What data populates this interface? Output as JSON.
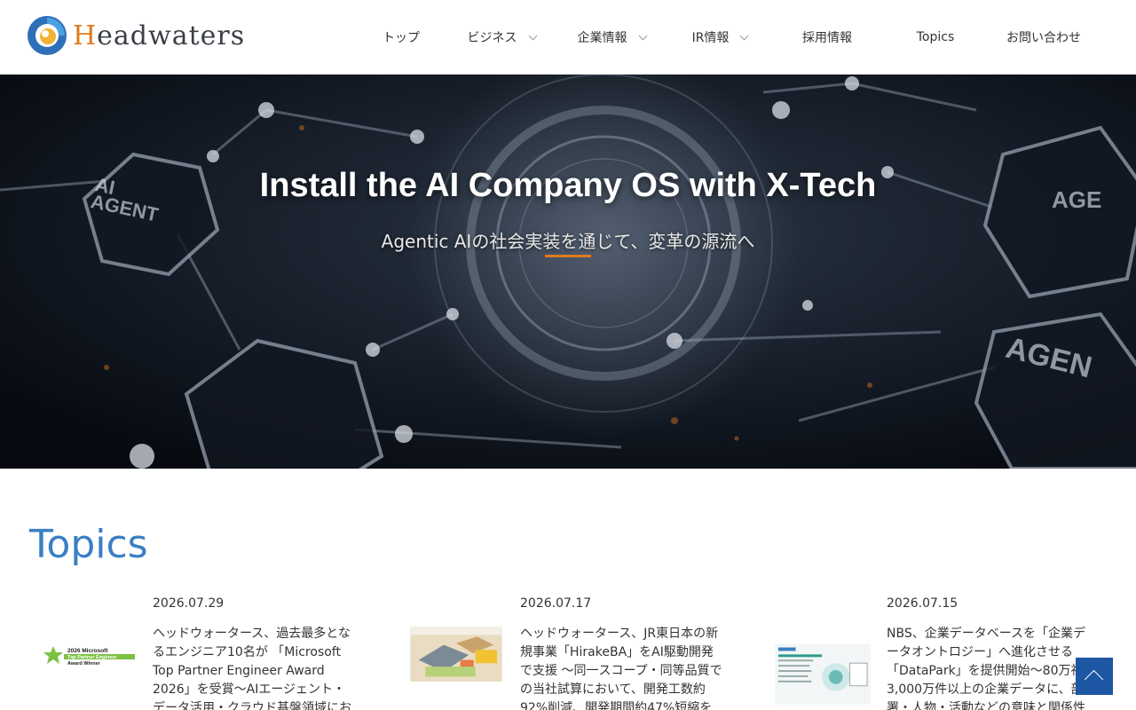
{
  "header": {
    "logo_text_initial": "H",
    "logo_text_rest": "eadwaters",
    "nav": [
      {
        "label": "トップ",
        "has_dropdown": false
      },
      {
        "label": "ビジネス",
        "has_dropdown": true
      },
      {
        "label": "企業情報",
        "has_dropdown": true
      },
      {
        "label": "IR情報",
        "has_dropdown": true
      },
      {
        "label": "採用情報",
        "has_dropdown": false
      },
      {
        "label": "Topics",
        "has_dropdown": false
      },
      {
        "label": "お問い合わせ",
        "has_dropdown": false
      }
    ]
  },
  "hero": {
    "title": "Install the AI Company OS with X-Tech",
    "subtitle": "Agentic AIの社会実装を通じて、変革の源流へ",
    "accent_color": "#e07a1f"
  },
  "topics": {
    "heading": "Topics",
    "items": [
      {
        "date": "2026.07.29",
        "title": "ヘッドウォータース、過去最多となるエンジニア10名が 「Microsoft Top Partner Engineer Award 2026」を受賞～AIエージェント・データ活用・クラウド基盤領域における実装",
        "thumb_lines": [
          "2026 Microsoft",
          "Top Partner Engineer",
          "Award Winner"
        ]
      },
      {
        "date": "2026.07.17",
        "title": "ヘッドウォータース、JR東日本の新規事業「HirakeBA」をAI駆動開発で支援 ～同一スコープ・同等品質での当社試算において、開発工数約92%削減、開発期間約47%短縮を実現～"
      },
      {
        "date": "2026.07.15",
        "title": "NBS、企業データベースを「企業データオントロジー」へ進化させる「DataPark」を提供開始～80万社3,000万件以上の企業データに、部署・人物・活動などの意味と関係性"
      }
    ]
  },
  "colors": {
    "brand_blue": "#3a7fc4",
    "brand_orange": "#e07a1f",
    "pagetop_bg": "#1d57a3"
  }
}
